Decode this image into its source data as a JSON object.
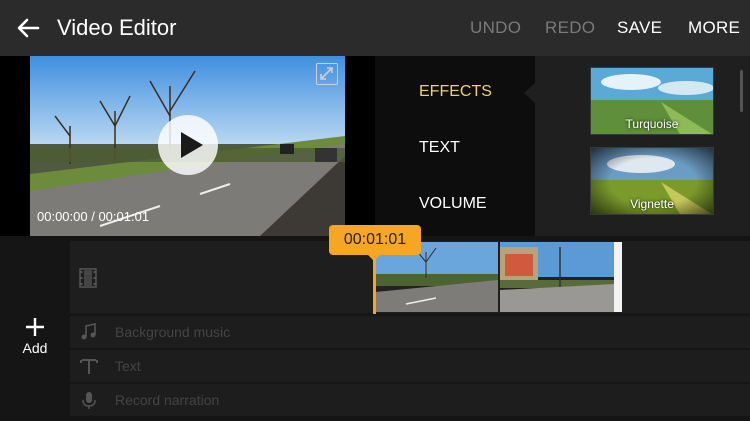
{
  "appbar": {
    "title": "Video Editor",
    "actions": {
      "undo": "UNDO",
      "redo": "REDO",
      "save": "SAVE",
      "more": "MORE"
    }
  },
  "preview": {
    "time_current": "00:00:00",
    "time_total": "00:01:01"
  },
  "menu": {
    "items": [
      "EFFECTS",
      "TEXT",
      "VOLUME"
    ]
  },
  "effects": {
    "items": [
      {
        "label": "Turquoise"
      },
      {
        "label": "Vignette"
      }
    ]
  },
  "timeline": {
    "playhead_time": "00:01:01"
  },
  "tracks": {
    "background_music": "Background music",
    "text": "Text",
    "record_narration": "Record narration"
  },
  "add": {
    "label": "Add"
  },
  "colors": {
    "accent": "#f5a623",
    "selected_menu": "#f1d26a",
    "disabled": "#7a7a7a"
  }
}
